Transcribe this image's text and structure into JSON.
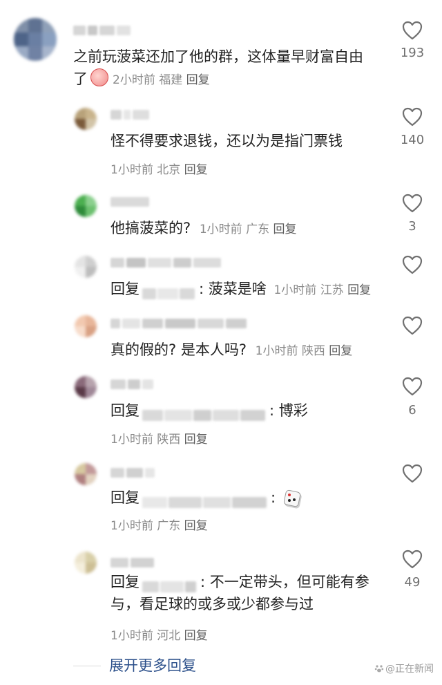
{
  "comments": [
    {
      "text": "之前玩菠菜还加了他的群，这体量早财富自由了",
      "time": "2小时前",
      "location": "福建",
      "reply": "回复",
      "likes": "193"
    },
    {
      "text": "怪不得要求退钱，还以为是指门票钱",
      "time": "1小时前",
      "location": "北京",
      "reply": "回复",
      "likes": "140"
    },
    {
      "text": "他搞菠菜的?",
      "time": "1小时前",
      "location": "广东",
      "reply": "回复",
      "likes": "3"
    },
    {
      "prefix": "回复",
      "sep": ":",
      "text": "菠菜是啥",
      "time": "1小时前",
      "location": "江苏",
      "reply": "回复",
      "likes": ""
    },
    {
      "text": "真的假的? 是本人吗?",
      "time": "1小时前",
      "location": "陕西",
      "reply": "回复",
      "likes": ""
    },
    {
      "prefix": "回复",
      "sep": ":",
      "text": "博彩",
      "time": "1小时前",
      "location": "陕西",
      "reply": "回复",
      "likes": "6"
    },
    {
      "prefix": "回复",
      "sep": ":",
      "text": "",
      "time": "1小时前",
      "location": "广东",
      "reply": "回复",
      "likes": ""
    },
    {
      "prefix": "回复",
      "sep": ":",
      "text": "不一定带头，但可能有参与，看足球的或多或少都参与过",
      "time": "1小时前",
      "location": "河北",
      "reply": "回复",
      "likes": "49"
    }
  ],
  "expand_label": "展开更多回复",
  "watermark": "@正在新闻",
  "icons": {
    "like": "heart-outline-icon",
    "emoji_peach": "peach-emoji-icon",
    "dice": "dice-emoji-icon"
  },
  "colors": {
    "link": "#2b4f8a",
    "meta": "#8a8a8a",
    "text": "#222222"
  }
}
